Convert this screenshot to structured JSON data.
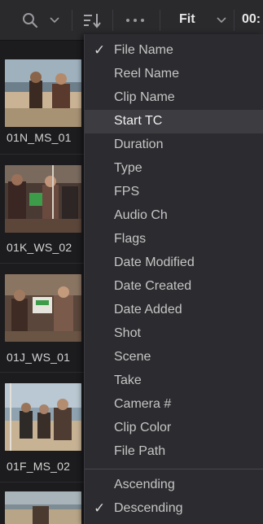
{
  "toolbar": {
    "zoom_value": "Fit",
    "timecode_partial": "00:",
    "icons": [
      "search-icon",
      "chevron-down-icon",
      "sort-icon",
      "more-options-icon",
      "chevron-down-icon"
    ]
  },
  "clips": [
    {
      "name": ""
    },
    {
      "name": "01N_MS_01"
    },
    {
      "name": "01K_WS_02"
    },
    {
      "name": "01J_WS_01"
    },
    {
      "name": "01F_MS_02"
    }
  ],
  "sort_menu": {
    "fields": [
      {
        "label": "File Name",
        "checked": true
      },
      {
        "label": "Reel Name",
        "checked": false
      },
      {
        "label": "Clip Name",
        "checked": false
      },
      {
        "label": "Start TC",
        "checked": false,
        "hovered": true
      },
      {
        "label": "Duration",
        "checked": false
      },
      {
        "label": "Type",
        "checked": false
      },
      {
        "label": "FPS",
        "checked": false
      },
      {
        "label": "Audio Ch",
        "checked": false
      },
      {
        "label": "Flags",
        "checked": false
      },
      {
        "label": "Date Modified",
        "checked": false
      },
      {
        "label": "Date Created",
        "checked": false
      },
      {
        "label": "Date Added",
        "checked": false
      },
      {
        "label": "Shot",
        "checked": false
      },
      {
        "label": "Scene",
        "checked": false
      },
      {
        "label": "Take",
        "checked": false
      },
      {
        "label": "Camera #",
        "checked": false
      },
      {
        "label": "Clip Color",
        "checked": false
      },
      {
        "label": "File Path",
        "checked": false
      }
    ],
    "order": [
      {
        "label": "Ascending",
        "checked": false
      },
      {
        "label": "Descending",
        "checked": true
      }
    ],
    "check_glyph": "✓"
  },
  "colors": {
    "toolbar_bg": "#2a2a2d",
    "menu_bg": "#2c2c30",
    "menu_hover": "#3c3c41",
    "text": "#c5c5c5"
  }
}
